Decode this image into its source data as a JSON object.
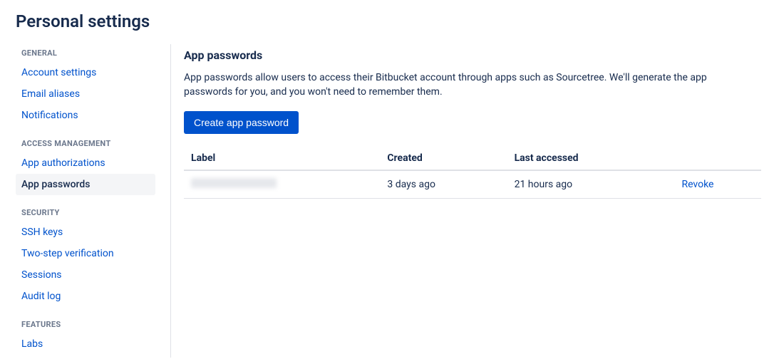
{
  "page_title": "Personal settings",
  "sidebar": {
    "groups": [
      {
        "header": "GENERAL",
        "items": [
          {
            "label": "Account settings",
            "active": false
          },
          {
            "label": "Email aliases",
            "active": false
          },
          {
            "label": "Notifications",
            "active": false
          }
        ]
      },
      {
        "header": "ACCESS MANAGEMENT",
        "items": [
          {
            "label": "App authorizations",
            "active": false
          },
          {
            "label": "App passwords",
            "active": true
          }
        ]
      },
      {
        "header": "SECURITY",
        "items": [
          {
            "label": "SSH keys",
            "active": false
          },
          {
            "label": "Two-step verification",
            "active": false
          },
          {
            "label": "Sessions",
            "active": false
          },
          {
            "label": "Audit log",
            "active": false
          }
        ]
      },
      {
        "header": "FEATURES",
        "items": [
          {
            "label": "Labs",
            "active": false
          }
        ]
      }
    ]
  },
  "main": {
    "title": "App passwords",
    "description": "App passwords allow users to access their Bitbucket account through apps such as Sourcetree. We'll generate the app passwords for you, and you won't need to remember them.",
    "create_button": "Create app password",
    "table": {
      "headers": {
        "label": "Label",
        "created": "Created",
        "last_accessed": "Last accessed"
      },
      "rows": [
        {
          "label": "",
          "created": "3 days ago",
          "last_accessed": "21 hours ago",
          "action": "Revoke"
        }
      ]
    }
  }
}
